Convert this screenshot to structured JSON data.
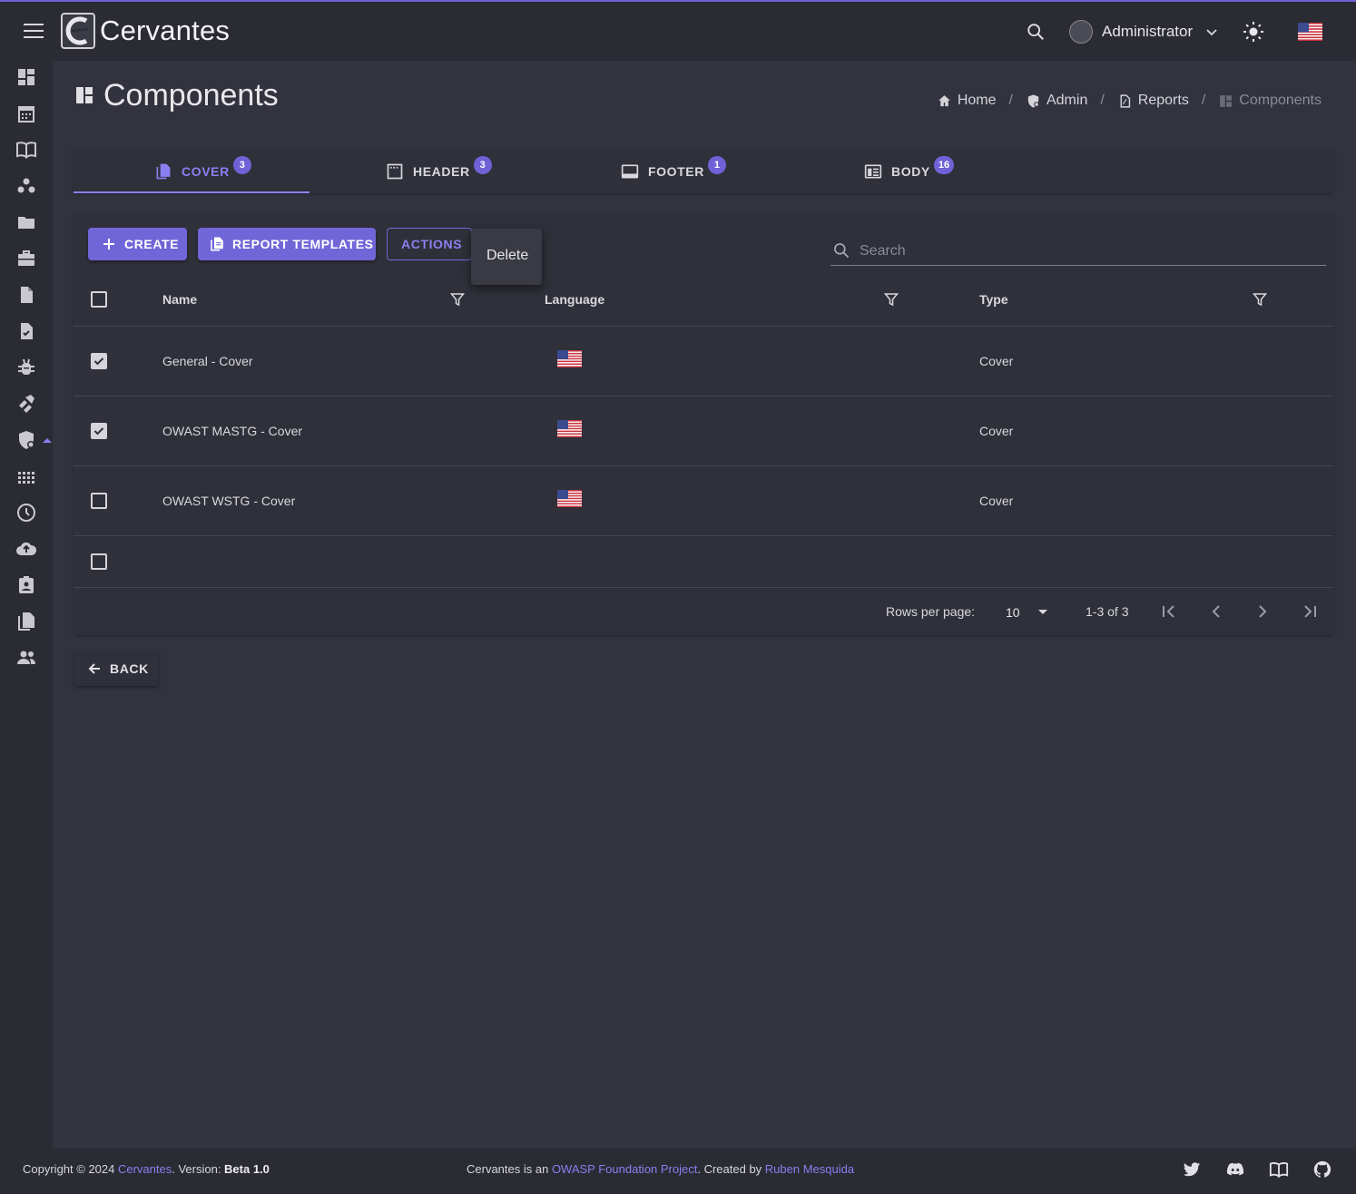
{
  "app": {
    "title": "Cervantes"
  },
  "topbar": {
    "user_name": "Administrator"
  },
  "page": {
    "title": "Components"
  },
  "breadcrumb": [
    {
      "label": "Home"
    },
    {
      "label": "Admin"
    },
    {
      "label": "Reports"
    },
    {
      "label": "Components"
    }
  ],
  "tabs": [
    {
      "label": "COVER",
      "badge": "3",
      "active": true
    },
    {
      "label": "HEADER",
      "badge": "3"
    },
    {
      "label": "FOOTER",
      "badge": "1"
    },
    {
      "label": "BODY",
      "badge": "16"
    }
  ],
  "toolbar": {
    "create_label": "CREATE",
    "templates_label": "REPORT TEMPLATES",
    "actions_label": "ACTIONS",
    "menu_delete": "Delete"
  },
  "search": {
    "placeholder": "Search",
    "value": ""
  },
  "table": {
    "columns": [
      "Name",
      "Language",
      "Type"
    ],
    "rows": [
      {
        "name": "General - Cover",
        "language": "en-us-flag",
        "type": "Cover",
        "checked": true
      },
      {
        "name": "OWAST MASTG - Cover",
        "language": "en-us-flag",
        "type": "Cover",
        "checked": true
      },
      {
        "name": "OWAST WSTG - Cover",
        "language": "en-us-flag",
        "type": "Cover",
        "checked": false
      }
    ]
  },
  "pagination": {
    "rows_per_page_label": "Rows per page:",
    "rows_per_page": "10",
    "range": "1-3 of 3"
  },
  "back_label": "BACK",
  "footer": {
    "copyright": "Copyright © 2024 ",
    "cervantes_link": "Cervantes",
    "version_prefix": ". Version: ",
    "version": "Beta 1.0",
    "project_prefix": "Cervantes is an ",
    "owasp_link": "OWASP Foundation Project",
    "created_by": ". Created by ",
    "author_link": "Ruben Mesquida"
  },
  "colors": {
    "accent": "#7166d8",
    "accent_text": "#8b7ff0",
    "background": "#32333e",
    "surface": "#2f3039",
    "bar": "#2a2b33"
  }
}
